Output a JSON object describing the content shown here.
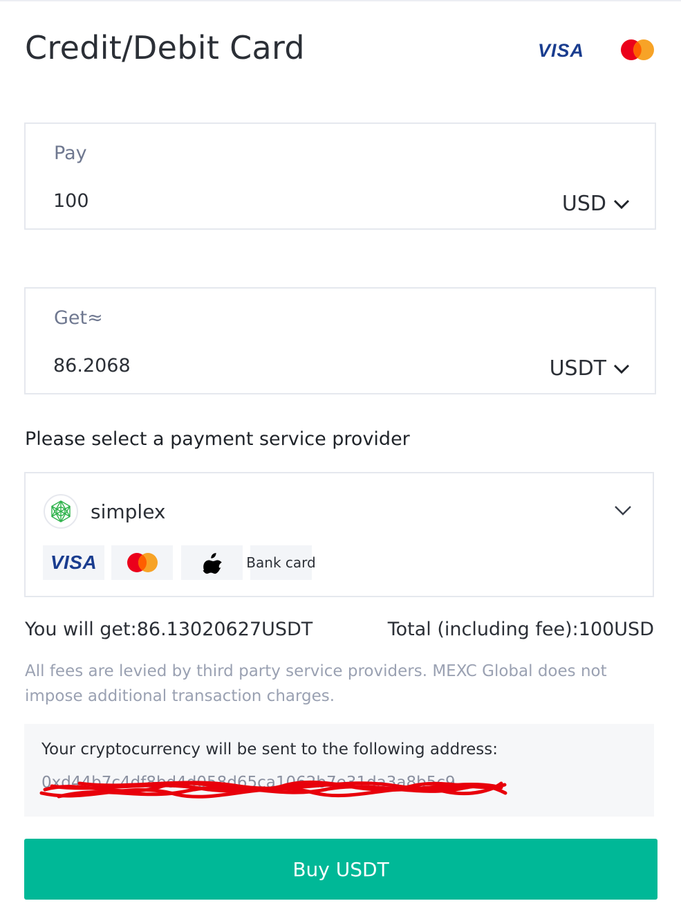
{
  "header": {
    "title": "Credit/Debit Card",
    "brands": [
      "VISA",
      "Mastercard"
    ],
    "visa_label": "VISA"
  },
  "pay": {
    "label": "Pay",
    "value": "100",
    "currency": "USD"
  },
  "get": {
    "label": "Get≈",
    "value": "86.2068",
    "currency": "USDT"
  },
  "provider_section": {
    "title": "Please select a payment service provider",
    "selected": {
      "name": "simplex",
      "methods": [
        {
          "name": "VISA",
          "icon": "visa-icon"
        },
        {
          "name": "Mastercard",
          "icon": "mastercard-icon"
        },
        {
          "name": "Apple Pay",
          "icon": "apple-icon"
        },
        {
          "name": "Bank card",
          "icon": "bank-card"
        }
      ],
      "visa_label": "VISA",
      "bank_label": "Bank card"
    }
  },
  "summary": {
    "you_will_get": "You will get:86.13020627USDT",
    "total": "Total (including fee):100USD"
  },
  "disclaimer": "All fees are levied by third party service providers. MEXC Global does not impose additional transaction charges.",
  "address": {
    "label": "Your cryptocurrency will be sent to the following address:",
    "value": "0xd44b7c4df8bd4d058d65ca1062b7e31da3a8b5c9"
  },
  "buy_button": {
    "label": "Buy USDT"
  },
  "colors": {
    "accent": "#00b897",
    "visa_blue": "#1a3d8f",
    "mc_red": "#eb001b",
    "mc_orange": "#f79e1b",
    "redaction": "#e8000b"
  }
}
